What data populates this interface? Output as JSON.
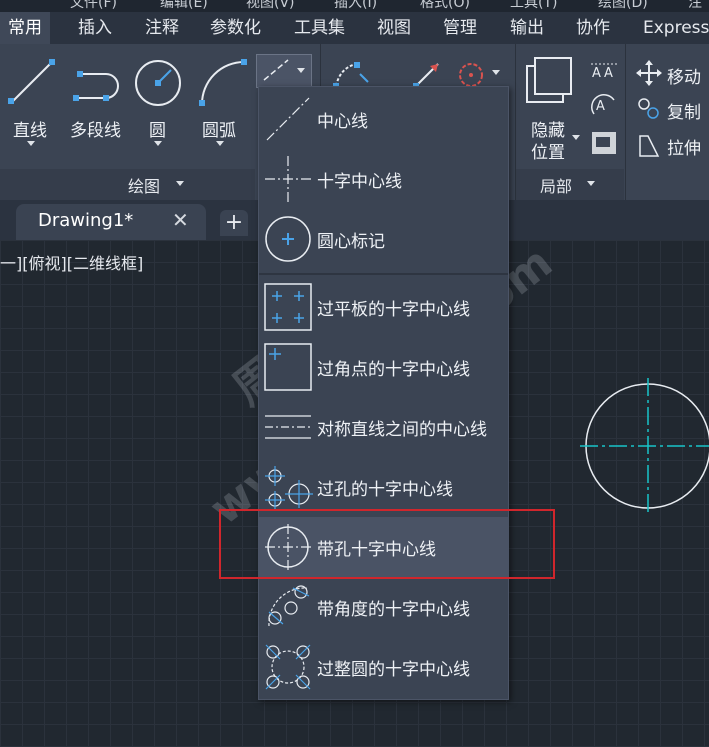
{
  "menu": {
    "items": [
      "文件(F)",
      "编辑(E)",
      "视图(V)",
      "插入(I)",
      "格式(O)",
      "工具(T)",
      "绘图(D)",
      "注"
    ]
  },
  "ribbon_tabs": [
    "常用",
    "插入",
    "注释",
    "参数化",
    "工具集",
    "视图",
    "管理",
    "输出",
    "协作",
    "Express"
  ],
  "draw_panel": {
    "tools": [
      "直线",
      "多段线",
      "圆",
      "圆弧"
    ],
    "title": "绘图"
  },
  "layers_panel": {
    "hide_label_1": "隐藏",
    "hide_label_2": "位置",
    "title": "局部"
  },
  "modify_panel": {
    "items": [
      "移动",
      "复制",
      "拉伸"
    ]
  },
  "document": {
    "tab_title": "Drawing1*",
    "close_symbol": "✕",
    "add_symbol": "+",
    "view_label": "一][俯视][二维线框]"
  },
  "dropdown": {
    "items": [
      {
        "label": "中心线",
        "icon": "centerline-icon"
      },
      {
        "label": "十字中心线",
        "icon": "cross-centerline-icon"
      },
      {
        "label": "圆心标记",
        "icon": "center-mark-icon"
      },
      {
        "label": "过平板的十字中心线",
        "icon": "plate-cross-icon"
      },
      {
        "label": "过角点的十字中心线",
        "icon": "corner-cross-icon"
      },
      {
        "label": "对称直线之间的中心线",
        "icon": "symmetric-lines-icon"
      },
      {
        "label": "过孔的十字中心线",
        "icon": "hole-cross-icon"
      },
      {
        "label": "带孔十字中心线",
        "icon": "cross-with-hole-icon"
      },
      {
        "label": "带角度的十字中心线",
        "icon": "angled-cross-icon"
      },
      {
        "label": "过整圆的十字中心线",
        "icon": "full-circle-cross-icon"
      }
    ],
    "highlighted_index": 7
  },
  "watermark": {
    "line1": "周站长CAD",
    "line2": "www.zzzcad.com"
  },
  "colors": {
    "accent_blue": "#4aa3e8",
    "centerline_cyan": "#19c4c9",
    "highlight_red": "#d0262c"
  }
}
